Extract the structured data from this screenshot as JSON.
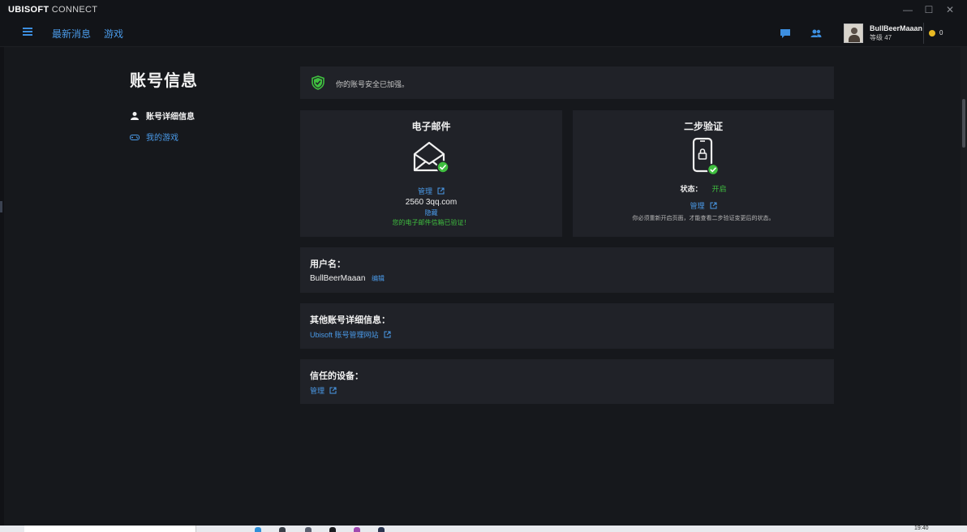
{
  "window": {
    "title_brand": "UBISOFT",
    "title_rest": " CONNECT",
    "controls": [
      "—",
      "☐",
      "✕"
    ]
  },
  "nav": {
    "news": "最新消息",
    "games": "游戏"
  },
  "profile": {
    "name": "BullBeerMaaan",
    "level": "等级 47",
    "coins": "0"
  },
  "sidebar": {
    "title": "账号信息",
    "items": [
      {
        "label": "账号详细信息",
        "icon": "user-icon",
        "active": true
      },
      {
        "label": "我的游戏",
        "icon": "gamepad-icon",
        "active": false
      }
    ]
  },
  "banner": {
    "text": "你的账号安全已加强。",
    "icon": "shield-check-icon"
  },
  "email_card": {
    "title": "电子邮件",
    "manage": "管理",
    "address": "2560          3qq.com",
    "hide": "隐藏",
    "verified": "您的电子邮件信箱已验证！"
  },
  "twofa_card": {
    "title": "二步验证",
    "status_label": "状态：",
    "status_value": "开启",
    "manage": "管理",
    "note": "你必须重新开启页面，才能查看二步验证变更后的状态。"
  },
  "username_section": {
    "label": "用户名：",
    "value": "BullBeerMaaan",
    "edit": "编辑"
  },
  "other_section": {
    "label": "其他账号详细信息：",
    "link": "Ubisoft 账号管理网站"
  },
  "devices_section": {
    "label": "信任的设备：",
    "link": "管理"
  },
  "taskbar": {
    "clock": "19:40"
  },
  "colors": {
    "accent": "#4a9ae8",
    "success": "#3fbf3f",
    "card": "#202228",
    "background": "#16181c"
  }
}
